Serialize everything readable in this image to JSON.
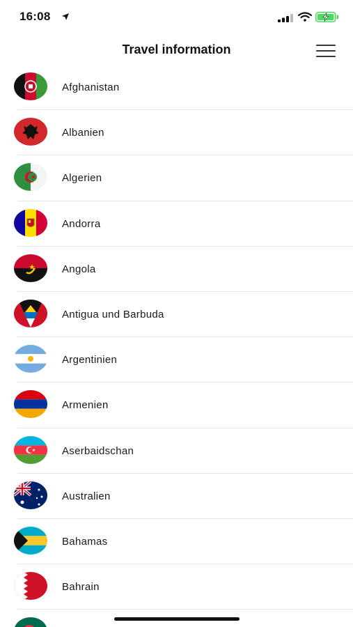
{
  "status_bar": {
    "time": "16:08"
  },
  "header": {
    "title": "Travel information"
  },
  "countries": [
    {
      "name": "Afghanistan"
    },
    {
      "name": "Albanien"
    },
    {
      "name": "Algerien"
    },
    {
      "name": "Andorra"
    },
    {
      "name": "Angola"
    },
    {
      "name": "Antigua und Barbuda"
    },
    {
      "name": "Argentinien"
    },
    {
      "name": "Armenien"
    },
    {
      "name": "Aserbaidschan"
    },
    {
      "name": "Australien"
    },
    {
      "name": "Bahamas"
    },
    {
      "name": "Bahrain"
    },
    {
      "name": ""
    }
  ],
  "icons": [
    "location-arrow-icon",
    "signal-icon",
    "wifi-icon",
    "battery-charging-icon",
    "hamburger-menu-icon"
  ],
  "colors": {
    "separator": "#e6e6e6",
    "battery_green": "#4cd964",
    "text": "#111111"
  }
}
